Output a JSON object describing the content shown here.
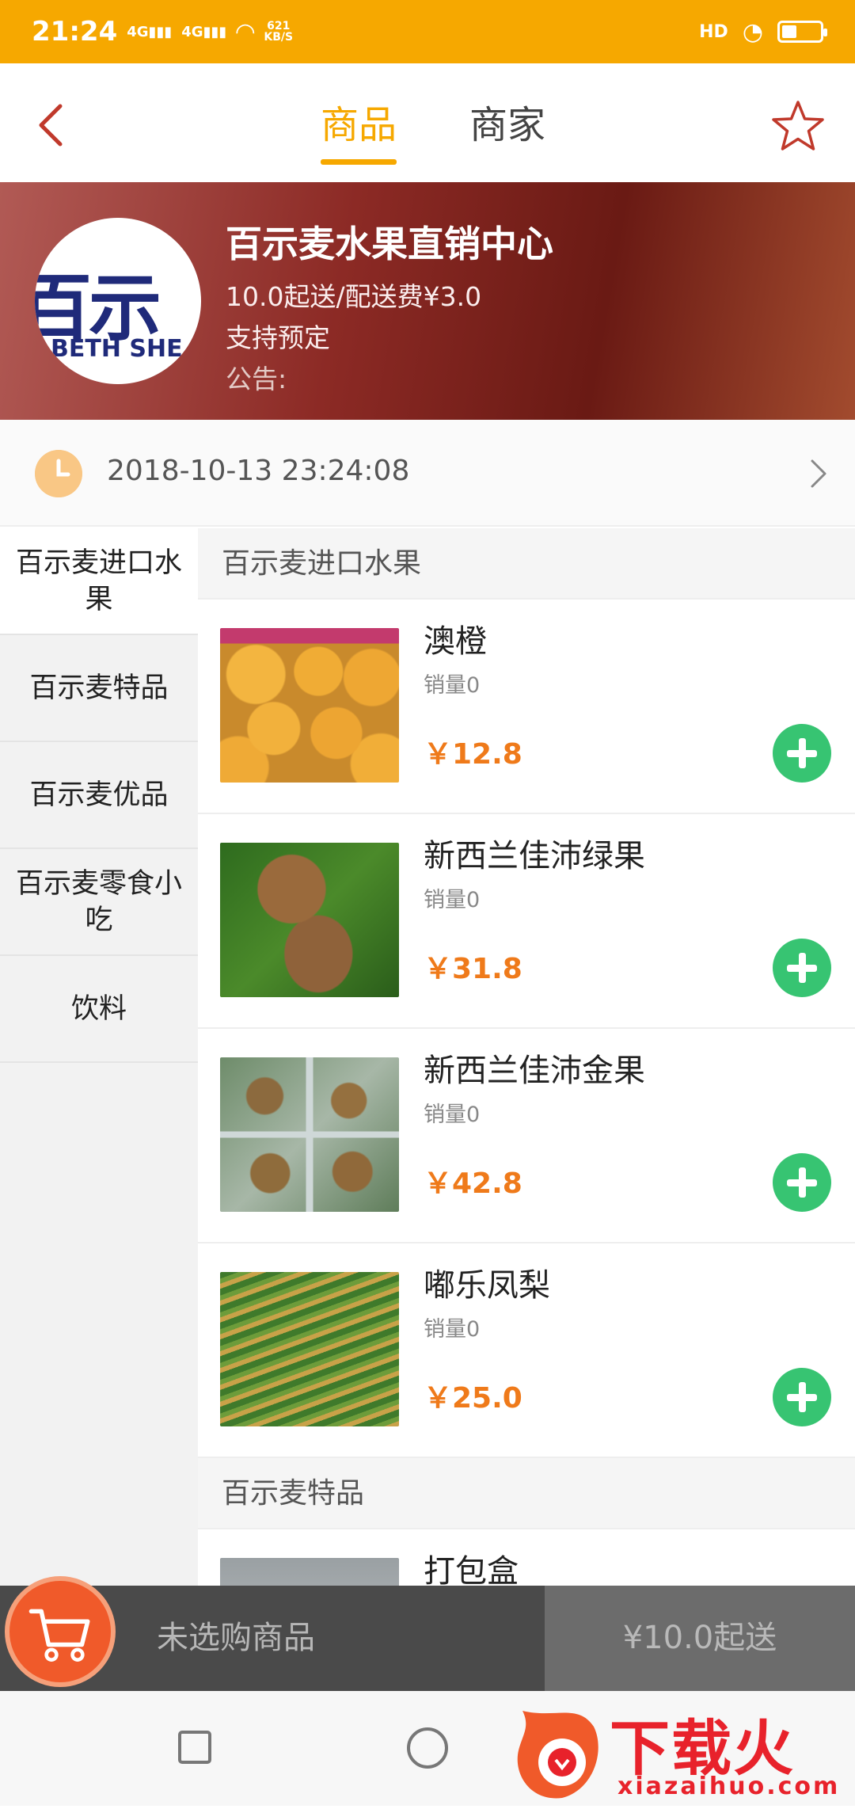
{
  "status_bar": {
    "time": "21:24",
    "signal1": "4G",
    "signal2": "4G",
    "net_speed_value": "621",
    "net_speed_unit": "KB/S",
    "hd_label": "HD"
  },
  "header": {
    "tabs": [
      {
        "label": "商品",
        "active": true
      },
      {
        "label": "商家",
        "active": false
      }
    ]
  },
  "shop": {
    "name": "百示麦水果直销中心",
    "delivery": "10.0起送/配送费¥3.0",
    "preorder": "支持预定",
    "notice": "公告:",
    "logo_cn": "百示麦",
    "logo_en": "BETH SHE"
  },
  "time_row": {
    "datetime": "2018-10-13 23:24:08"
  },
  "categories": [
    {
      "label": "百示麦进口水果",
      "active": true
    },
    {
      "label": "百示麦特品",
      "active": false
    },
    {
      "label": "百示麦优品",
      "active": false
    },
    {
      "label": "百示麦零食小吃",
      "active": false
    },
    {
      "label": "饮料",
      "active": false
    }
  ],
  "sections": [
    {
      "title": "百示麦进口水果",
      "products": [
        {
          "name": "澳橙",
          "sales": "销量0",
          "price": "￥12.8"
        },
        {
          "name": "新西兰佳沛绿果",
          "sales": "销量0",
          "price": "￥31.8"
        },
        {
          "name": "新西兰佳沛金果",
          "sales": "销量0",
          "price": "￥42.8"
        },
        {
          "name": "嘟乐凤梨",
          "sales": "销量0",
          "price": "￥25.0"
        }
      ]
    },
    {
      "title": "百示麦特品",
      "products": [
        {
          "name": "打包盒"
        }
      ]
    }
  ],
  "cart": {
    "status": "未选购商品",
    "checkout": "¥10.0起送"
  },
  "watermark": {
    "brand": "下载火",
    "url": "xiazaihuo.com"
  },
  "colors": {
    "accent": "#f6a800",
    "price": "#ef7a1a",
    "add": "#37c472",
    "cart": "#f05a2a"
  }
}
